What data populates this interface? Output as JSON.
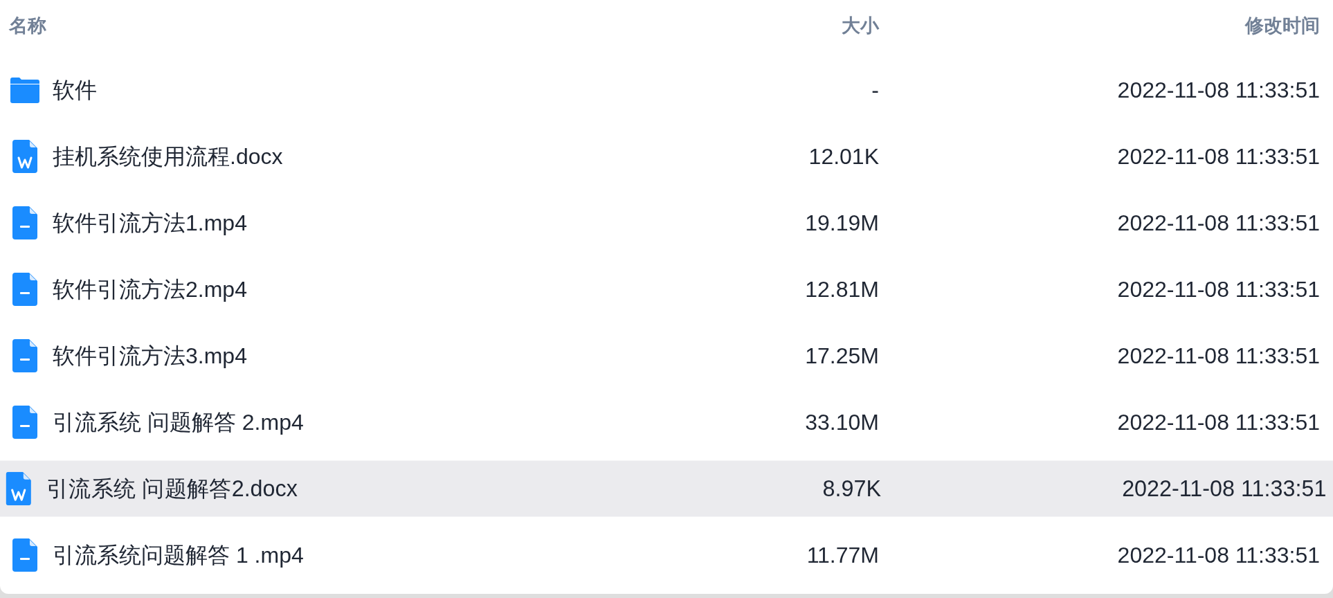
{
  "columns": [
    {
      "label": "名称"
    },
    {
      "label": "大小"
    },
    {
      "label": "修改时间"
    }
  ],
  "rows": [
    {
      "kind": "folder",
      "name": "软件",
      "size": "-",
      "modified": "2022-11-08 11:33:51",
      "hovered": false
    },
    {
      "kind": "word",
      "name": "挂机系统使用流程.docx",
      "size": "12.01K",
      "modified": "2022-11-08 11:33:51",
      "hovered": false
    },
    {
      "kind": "file",
      "name": "软件引流方法1.mp4",
      "size": "19.19M",
      "modified": "2022-11-08 11:33:51",
      "hovered": false
    },
    {
      "kind": "file",
      "name": "软件引流方法2.mp4",
      "size": "12.81M",
      "modified": "2022-11-08 11:33:51",
      "hovered": false
    },
    {
      "kind": "file",
      "name": "软件引流方法3.mp4",
      "size": "17.25M",
      "modified": "2022-11-08 11:33:51",
      "hovered": false
    },
    {
      "kind": "file",
      "name": "引流系统 问题解答 2.mp4",
      "size": "33.10M",
      "modified": "2022-11-08 11:33:51",
      "hovered": false
    },
    {
      "kind": "word",
      "name": "引流系统 问题解答2.docx",
      "size": "8.97K",
      "modified": "2022-11-08 11:33:51",
      "hovered": true
    },
    {
      "kind": "file",
      "name": "引流系统问题解答 1 .mp4",
      "size": "11.77M",
      "modified": "2022-11-08 11:33:51",
      "hovered": false
    }
  ]
}
